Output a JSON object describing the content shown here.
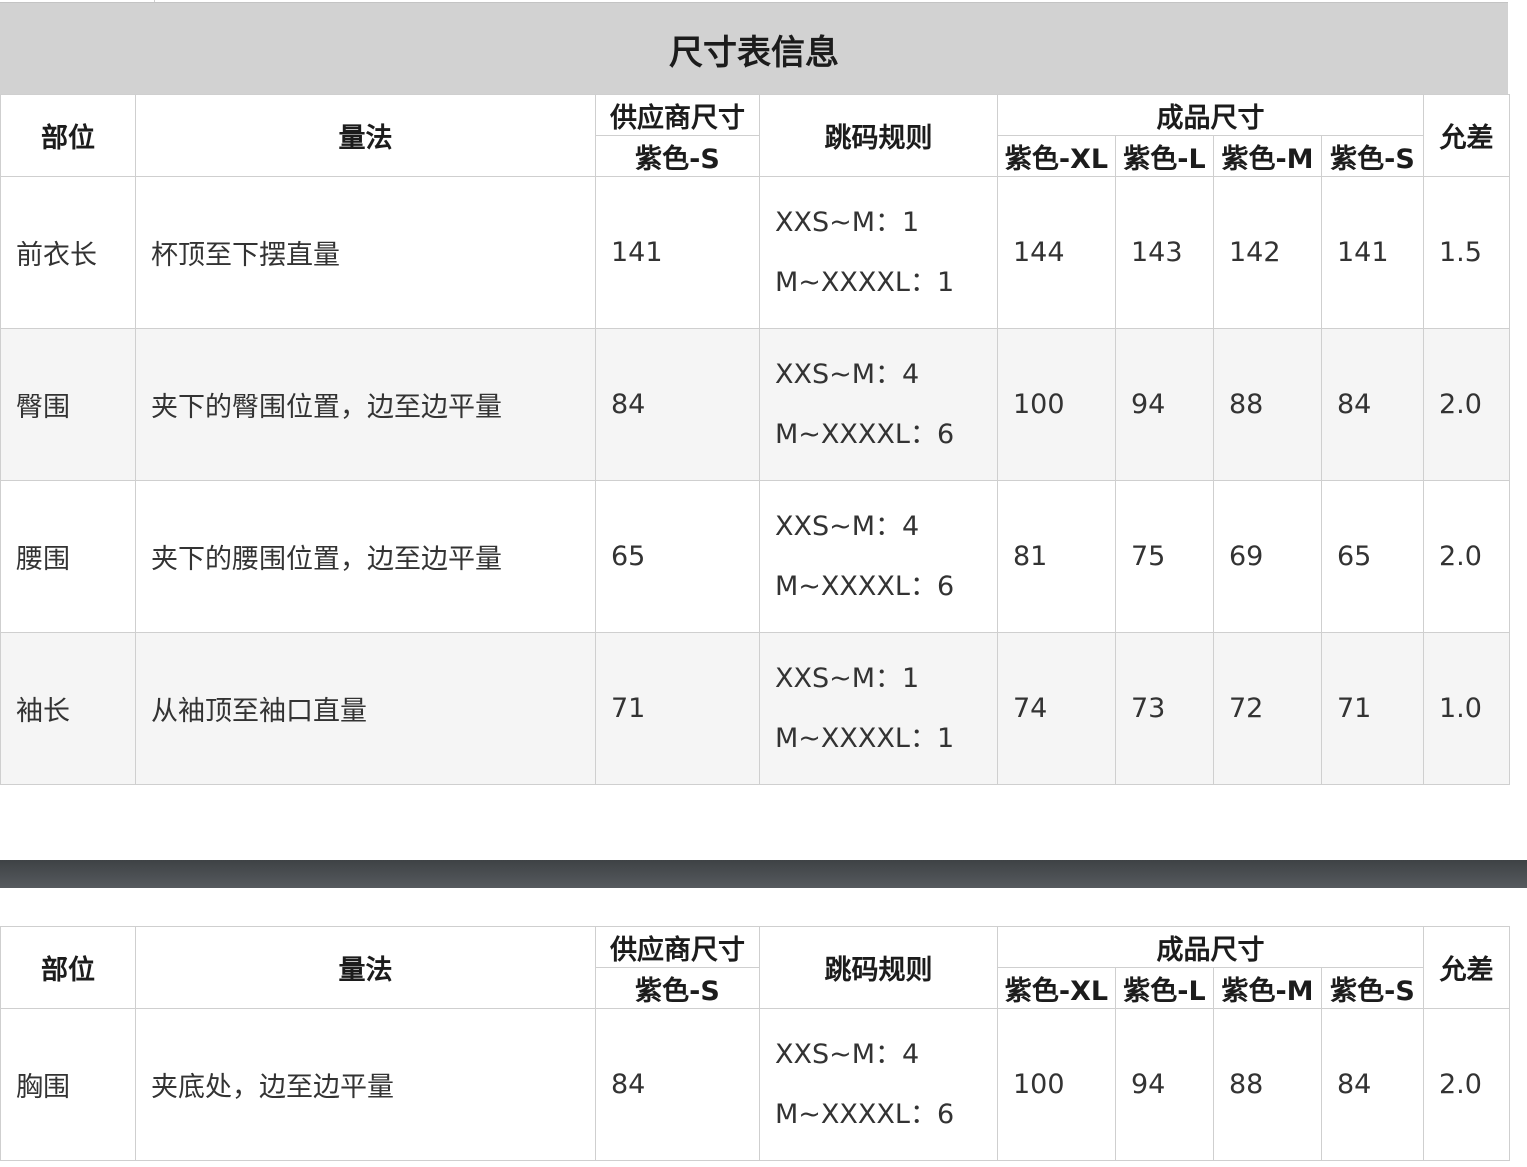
{
  "title": "尺寸表信息",
  "headers": {
    "part": "部位",
    "method": "量法",
    "supplier_size": "供应商尺寸",
    "supplier_variant": "紫色-S",
    "jump_rule": "跳码规则",
    "finished_size": "成品尺寸",
    "finished_variants": [
      "紫色-XL",
      "紫色-L",
      "紫色-M",
      "紫色-S"
    ],
    "tolerance": "允差"
  },
  "table1": {
    "rows": [
      {
        "part": "前衣长",
        "method": "杯顶至下摆直量",
        "supplier": "141",
        "rule1": "XXS~M：1",
        "rule2": "M~XXXXL：1",
        "xl": "144",
        "l": "143",
        "m": "142",
        "s": "141",
        "tol": "1.5"
      },
      {
        "part": "臀围",
        "method": "夹下的臀围位置，边至边平量",
        "supplier": "84",
        "rule1": "XXS~M：4",
        "rule2": "M~XXXXL：6",
        "xl": "100",
        "l": "94",
        "m": "88",
        "s": "84",
        "tol": "2.0"
      },
      {
        "part": "腰围",
        "method": "夹下的腰围位置，边至边平量",
        "supplier": "65",
        "rule1": "XXS~M：4",
        "rule2": "M~XXXXL：6",
        "xl": "81",
        "l": "75",
        "m": "69",
        "s": "65",
        "tol": "2.0"
      },
      {
        "part": "袖长",
        "method": "从袖顶至袖口直量",
        "supplier": "71",
        "rule1": "XXS~M：1",
        "rule2": "M~XXXXL：1",
        "xl": "74",
        "l": "73",
        "m": "72",
        "s": "71",
        "tol": "1.0"
      }
    ]
  },
  "table2": {
    "rows": [
      {
        "part": "胸围",
        "method": "夹底处，边至边平量",
        "supplier": "84",
        "rule1": "XXS~M：4",
        "rule2": "M~XXXXL：6",
        "xl": "100",
        "l": "94",
        "m": "88",
        "s": "84",
        "tol": "2.0"
      }
    ]
  }
}
